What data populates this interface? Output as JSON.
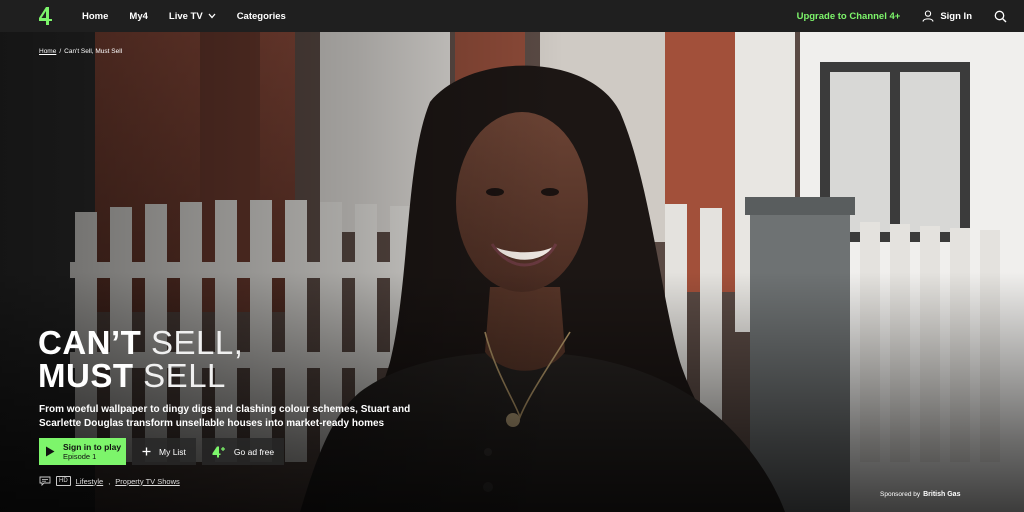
{
  "nav": {
    "logo_icon": "channel-4-logo",
    "items": [
      {
        "label": "Home"
      },
      {
        "label": "My4"
      },
      {
        "label": "Live TV",
        "has_dropdown": true
      },
      {
        "label": "Categories"
      }
    ],
    "upgrade_label": "Upgrade to Channel 4+",
    "signin_label": "Sign In",
    "search_icon": "search-icon"
  },
  "breadcrumb": {
    "home": "Home",
    "separator": "/",
    "current": "Can't Sell, Must Sell"
  },
  "show": {
    "title_line1_bold": "CAN’T",
    "title_line1_light": "SELL,",
    "title_line2_bold": "MUST",
    "title_line2_light": "SELL",
    "description": "From woeful wallpaper to dingy digs and clashing colour schemes, Stuart and Scarlette Douglas transform unsellable houses into market-ready homes"
  },
  "actions": {
    "play_label": "Sign in to play",
    "play_sublabel": "Episode 1",
    "mylist_label": "My List",
    "adfree_label": "Go ad free"
  },
  "meta": {
    "subtitles_icon": "subtitles-icon",
    "hd_badge": "HD",
    "categories": [
      "Lifestyle",
      "Property TV Shows"
    ],
    "category_separator": ","
  },
  "sponsor": {
    "prefix": "Sponsored by",
    "brand": "British Gas"
  },
  "colors": {
    "accent_green": "#7df56b",
    "nav_background": "#1f1f1f"
  }
}
